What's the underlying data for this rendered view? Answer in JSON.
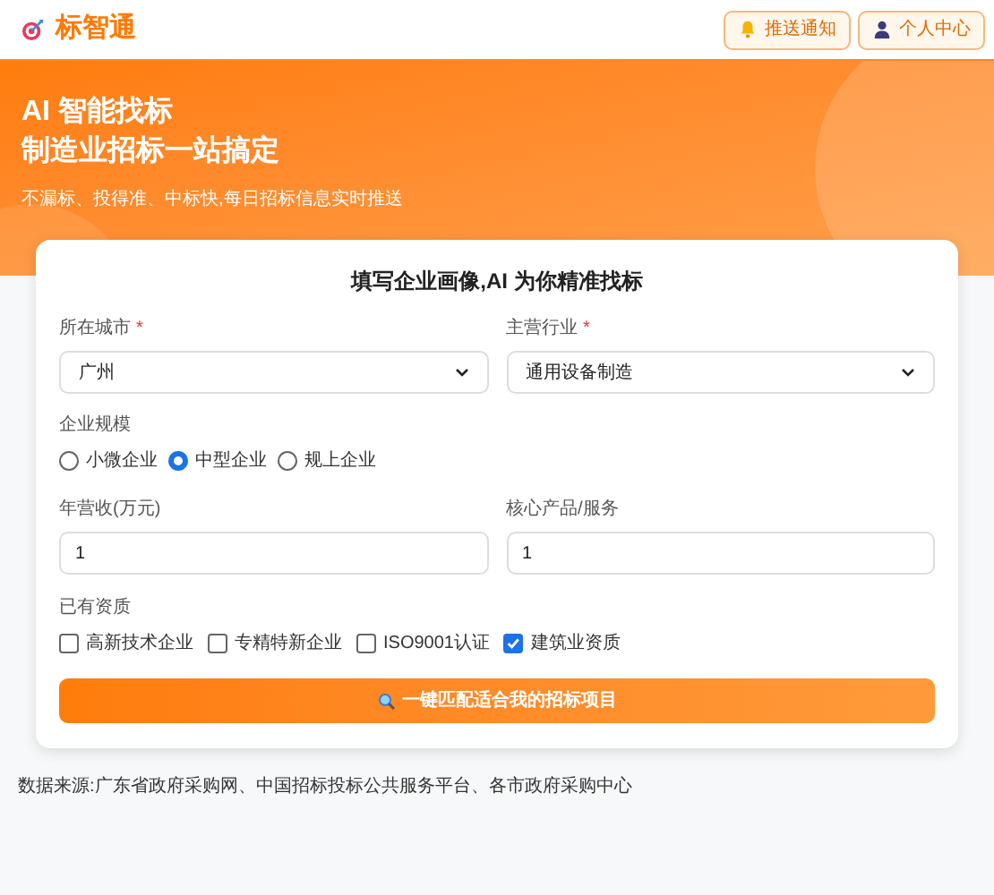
{
  "header": {
    "brand": "标智通",
    "buttons": [
      {
        "label": "推送通知"
      },
      {
        "label": "个人中心"
      }
    ]
  },
  "banner": {
    "title_lines": [
      "AI 智能找标",
      "制造业招标一站搞定"
    ],
    "subtitle": "不漏标、投得准、中标快,每日招标信息实时推送"
  },
  "form": {
    "title": "填写企业画像,AI 为你精准找标",
    "selects": [
      {
        "label": "所在城市",
        "required_mark": "*",
        "value": "广州"
      },
      {
        "label": "主营行业",
        "required_mark": "*",
        "value": "通用设备制造"
      }
    ],
    "scale": {
      "label": "企业规模",
      "options": [
        {
          "label": "小微企业",
          "selected": false
        },
        {
          "label": "中型企业",
          "selected": true
        },
        {
          "label": "规上企业",
          "selected": false
        }
      ]
    },
    "inputs": [
      {
        "label": "年营收(万元)",
        "value": "1"
      },
      {
        "label": "核心产品/服务",
        "value": "1"
      }
    ],
    "qualifications": {
      "label": "已有资质",
      "options": [
        {
          "label": "高新技术企业",
          "checked": false
        },
        {
          "label": "专精特新企业",
          "checked": false
        },
        {
          "label": "ISO9001认证",
          "checked": false
        },
        {
          "label": "建筑业资质",
          "checked": true
        }
      ]
    },
    "submit": "一键匹配适合我的招标项目"
  },
  "footer": "数据来源:广东省政府采购网、中国招标投标公共服务平台、各市政府采购中心"
}
